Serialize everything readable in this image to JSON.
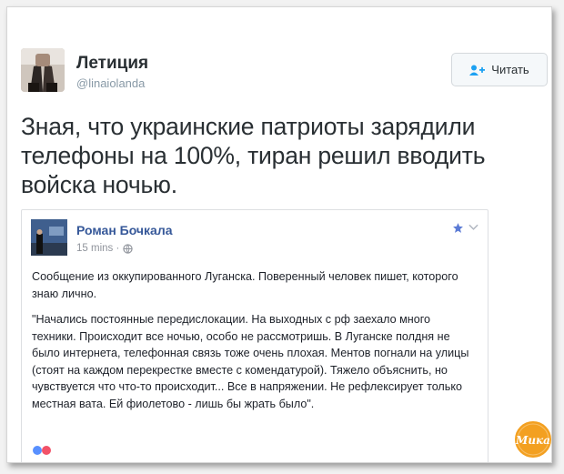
{
  "tweet": {
    "display_name": "Летиция",
    "handle": "@linaiolanda",
    "follow_label": "Читать",
    "text": "Зная, что украинские патриоты зарядили телефоны на 100%, тиран решил вводить войска ночью."
  },
  "embedded_post": {
    "author": "Роман Бочкала",
    "time": "15 mins ·",
    "paragraph_1": "Сообщение из оккупированного Луганска. Поверенный человек пишет, которого знаю лично.",
    "paragraph_2": "\"Начались постоянные передислокации. На выходных с рф заехало много техники. Происходит все ночью, особо не рассмотришь. В Луганске полдня не было интернета, телефонная связь тоже очень плохая. Ментов погнали на улицы (стоят на каждом перекрестке вместе с комендатурой). Тяжело объяснить, но чувствуется что что-то происходит... Все в напряжении. Не рефлексирует только местная вата. Ей фиолетово - лишь бы жрать было\"."
  },
  "watermark_text": "Мика",
  "icons": {
    "follow": "follow-user-icon",
    "privacy": "globe-icon",
    "bookmark": "star-icon",
    "menu": "chevron-down-icon"
  },
  "colors": {
    "fb_link": "#365899",
    "follow_icon": "#1da1f2",
    "watermark": "#f3a021"
  }
}
